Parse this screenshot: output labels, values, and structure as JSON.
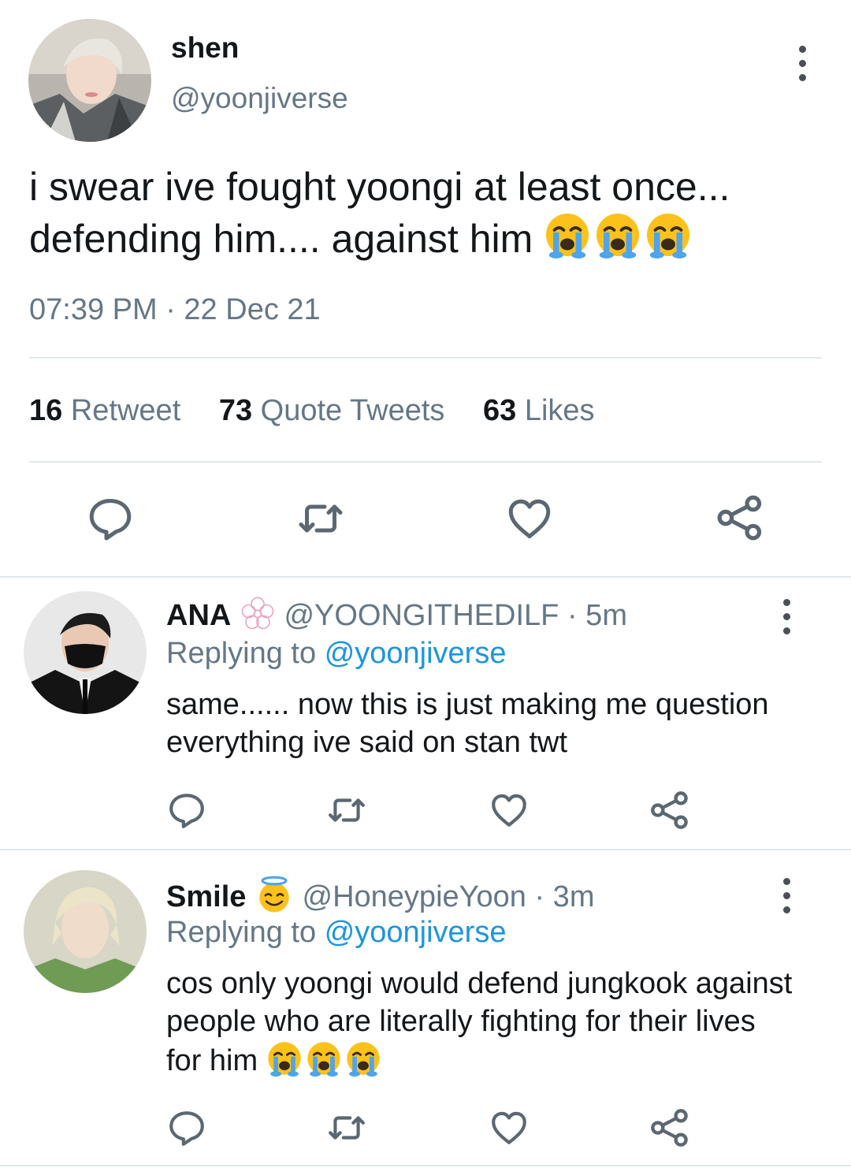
{
  "main_tweet": {
    "name": "shen",
    "handle": "@yoonjiverse",
    "text": "i swear ive fought yoongi at least once... defending him.... against him",
    "emojis": [
      "loudly-crying-face",
      "loudly-crying-face",
      "loudly-crying-face"
    ],
    "timestamp": "07:39 PM · 22 Dec 21",
    "stats": {
      "retweets_count": "16",
      "retweets_label": "Retweet",
      "quotes_count": "73",
      "quotes_label": "Quote Tweets",
      "likes_count": "63",
      "likes_label": "Likes"
    },
    "actions": [
      "reply-icon",
      "retweet-icon",
      "like-icon",
      "share-icon"
    ]
  },
  "replies": [
    {
      "name": "ANA",
      "name_badge_icon": "cherry-blossom-outline-icon",
      "handle": "@YOONGITHEDILF",
      "time": "· 5m",
      "replying_prefix": "Replying to",
      "replying_to": "@yoonjiverse",
      "text": "same...... now this is just making me question everything ive said on stan twt"
    },
    {
      "name": "Smile",
      "name_badge_icon": "smiling-face-with-halo-icon",
      "handle": "@HoneypieYoon",
      "time": "· 3m",
      "replying_prefix": "Replying to",
      "replying_to": "@yoonjiverse",
      "text": "cos only yoongi would defend jungkook against people who are literally fighting for their lives for him",
      "emojis": [
        "loudly-crying-face",
        "loudly-crying-face",
        "loudly-crying-face"
      ]
    }
  ],
  "colors": {
    "text": "#14171a",
    "muted": "#657786",
    "link": "#1b95e0",
    "divider": "#e1e8ed",
    "icon": "#5b6771"
  }
}
